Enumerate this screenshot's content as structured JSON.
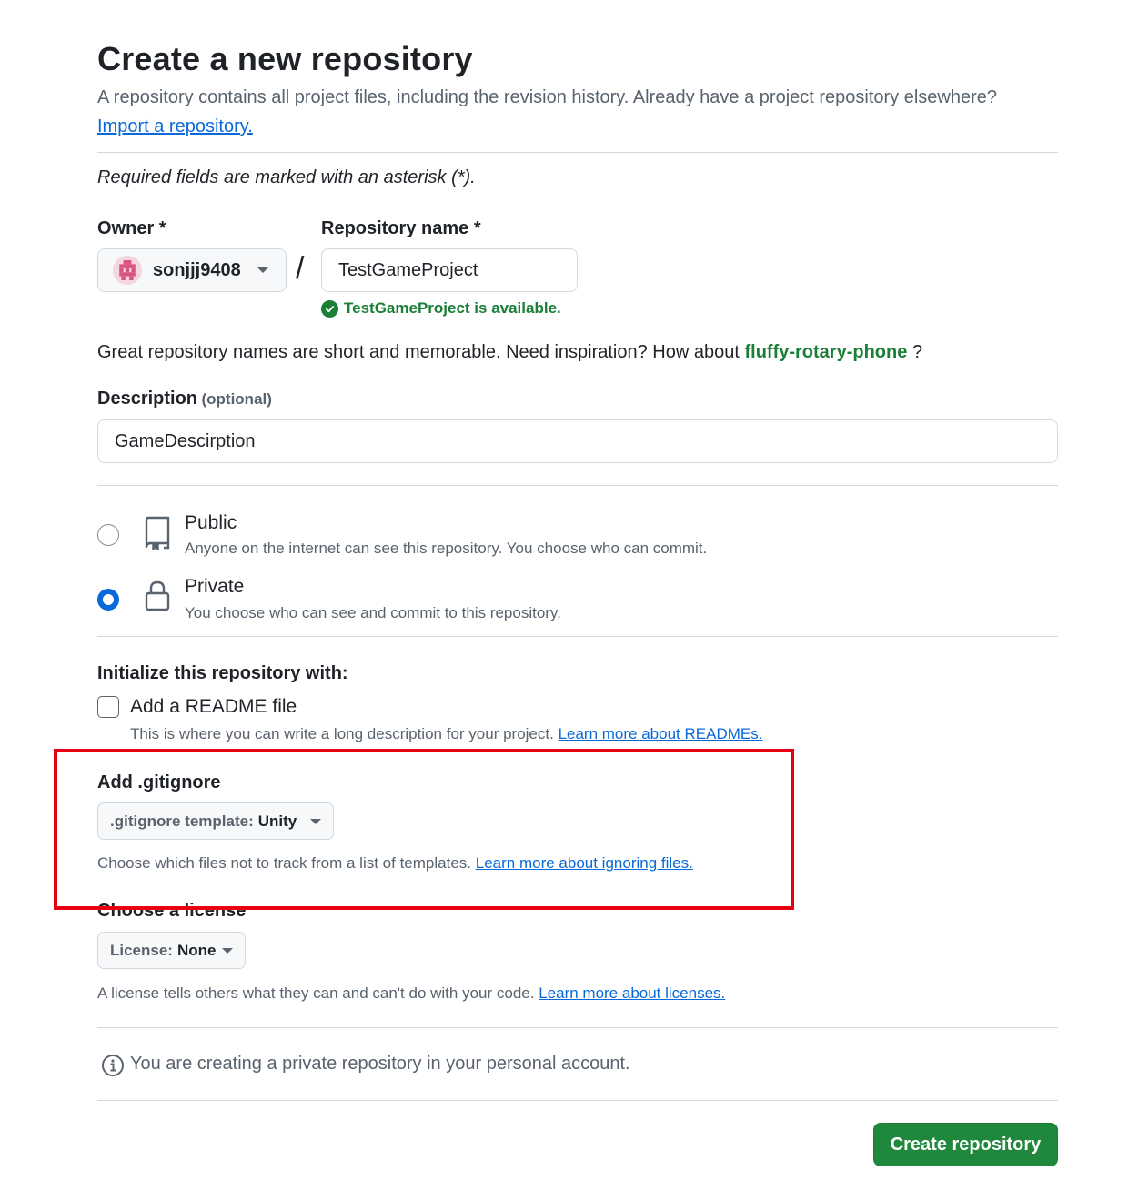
{
  "header": {
    "title": "Create a new repository",
    "subtitle": "A repository contains all project files, including the revision history. Already have a project repository elsewhere?",
    "import_link": "Import a repository."
  },
  "required_note": "Required fields are marked with an asterisk (*).",
  "owner": {
    "label": "Owner *",
    "value": "sonjjj9408"
  },
  "slash": "/",
  "repo_name": {
    "label": "Repository name *",
    "value": "TestGameProject",
    "availability": "TestGameProject is available."
  },
  "inspiration": {
    "text": "Great repository names are short and memorable. Need inspiration? How about",
    "suggestion": "fluffy-rotary-phone",
    "suffix": "?"
  },
  "description": {
    "label": "Description",
    "optional": "(optional)",
    "value": "GameDescirption"
  },
  "visibility": {
    "public": {
      "title": "Public",
      "desc": "Anyone on the internet can see this repository. You choose who can commit."
    },
    "private": {
      "title": "Private",
      "desc": "You choose who can see and commit to this repository."
    },
    "selected": "private"
  },
  "initialize": {
    "heading": "Initialize this repository with:",
    "readme_label": "Add a README file",
    "readme_help": "This is where you can write a long description for your project.",
    "readme_link": "Learn more about READMEs.",
    "readme_checked": false
  },
  "gitignore": {
    "heading": "Add .gitignore",
    "select_key": ".gitignore template:",
    "select_value": "Unity",
    "help": "Choose which files not to track from a list of templates.",
    "link": "Learn more about ignoring files."
  },
  "license": {
    "heading": "Choose a license",
    "select_key": "License:",
    "select_value": "None",
    "help": "A license tells others what they can and can't do with your code.",
    "link": "Learn more about licenses."
  },
  "info_notice": "You are creating a private repository in your personal account.",
  "create_button": "Create repository",
  "colors": {
    "link": "#0969da",
    "success": "#1a7f37",
    "primary_button": "#1f883d",
    "highlight_box": "#e60012"
  }
}
